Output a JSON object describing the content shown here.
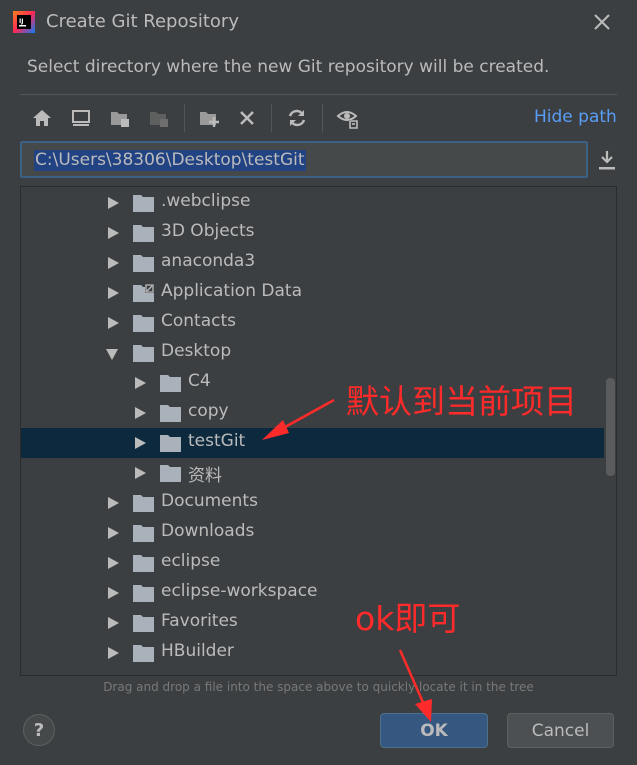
{
  "window": {
    "title": "Create Git Repository",
    "subtitle": "Select directory where the new Git repository will be created."
  },
  "toolbar": {
    "hide_path_label": "Hide path",
    "buttons": [
      "home-icon",
      "desktop-icon",
      "project-folder-icon",
      "module-folder-icon",
      "new-folder-icon",
      "delete-icon",
      "refresh-icon",
      "show-hidden-icon"
    ]
  },
  "path": {
    "value": "C:\\Users\\38306\\Desktop\\testGit"
  },
  "tree": {
    "items": [
      {
        "label": ".webclipse",
        "expanded": false
      },
      {
        "label": "3D Objects",
        "expanded": false
      },
      {
        "label": "anaconda3",
        "expanded": false
      },
      {
        "label": "Application Data",
        "expanded": false,
        "link": true
      },
      {
        "label": "Contacts",
        "expanded": false
      },
      {
        "label": "Desktop",
        "expanded": true
      },
      {
        "label": "C4",
        "expanded": false
      },
      {
        "label": "copy",
        "expanded": false
      },
      {
        "label": "testGit",
        "expanded": false,
        "selected": true
      },
      {
        "label": "资料",
        "expanded": false
      },
      {
        "label": "Documents",
        "expanded": false
      },
      {
        "label": "Downloads",
        "expanded": false
      },
      {
        "label": "eclipse",
        "expanded": false
      },
      {
        "label": "eclipse-workspace",
        "expanded": false
      },
      {
        "label": "Favorites",
        "expanded": false
      },
      {
        "label": "HBuilder",
        "expanded": false
      }
    ]
  },
  "hint": "Drag and drop a file into the space above to quickly locate it in the tree",
  "buttons": {
    "help": "?",
    "ok": "OK",
    "cancel": "Cancel"
  },
  "annotations": {
    "default_note": "默认到当前项目",
    "ok_note": "ok即可"
  },
  "colors": {
    "background": "#3c3f41",
    "selection": "#0d293e",
    "link": "#589df6",
    "annotation": "#ff2a2a",
    "ok_button": "#365880"
  }
}
